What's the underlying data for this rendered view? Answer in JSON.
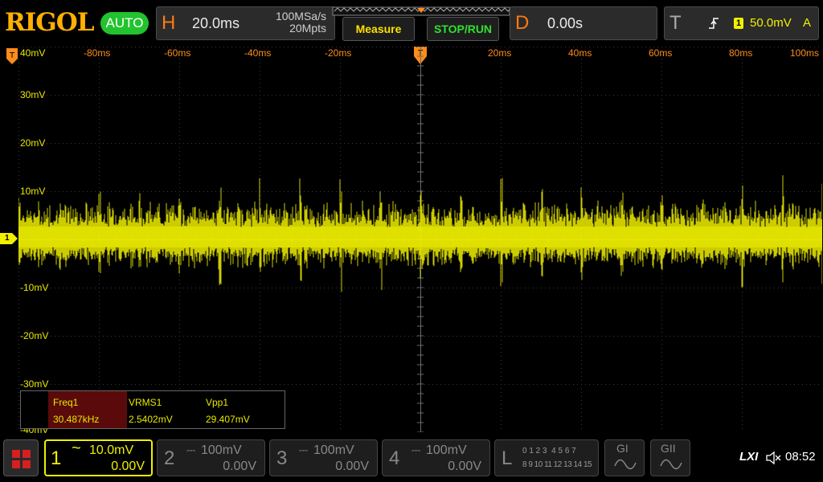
{
  "header": {
    "brand": "RIGOL",
    "trigger_mode": "AUTO",
    "horizontal": {
      "letter": "H",
      "timebase": "20.0ms",
      "sample_rate": "100MSa/s",
      "memory_depth": "20Mpts"
    },
    "measure_button": "Measure",
    "stop_run_button": "STOP/RUN",
    "delay": {
      "letter": "D",
      "value": "0.00s"
    },
    "trigger": {
      "letter": "T",
      "channel": "1",
      "level": "50.0mV",
      "source_mode": "A"
    }
  },
  "grid": {
    "time_labels": [
      "-80ms",
      "-60ms",
      "-40ms",
      "-20ms",
      "20ms",
      "40ms",
      "60ms",
      "80ms",
      "100ms"
    ],
    "volt_labels": [
      "40mV",
      "30mV",
      "20mV",
      "10mV",
      "-10mV",
      "-20mV",
      "-30mV",
      "-40mV"
    ],
    "channel_marker": "1",
    "colors": {
      "ch1": "#f0f000",
      "grid": "#3a3a3a",
      "time": "#ff8c1a"
    }
  },
  "measurements": [
    {
      "name": "Freq1",
      "value": "30.487kHz"
    },
    {
      "name": "VRMS1",
      "value": "2.5402mV"
    },
    {
      "name": "Vpp1",
      "value": "29.407mV"
    }
  ],
  "channels": [
    {
      "num": "1",
      "coupling": "~",
      "scale": "10.0mV",
      "offset": "0.00V"
    },
    {
      "num": "2",
      "coupling": "⎓",
      "scale": "100mV",
      "offset": "0.00V"
    },
    {
      "num": "3",
      "coupling": "⎓",
      "scale": "100mV",
      "offset": "0.00V"
    },
    {
      "num": "4",
      "coupling": "⎓",
      "scale": "100mV",
      "offset": "0.00V"
    }
  ],
  "logic": {
    "letter": "L",
    "row1": "0 1 2 3  4 5 6 7",
    "row2": "8 9 10 11 12 13 14 15"
  },
  "gen1": "GI",
  "gen2": "GII",
  "status": {
    "lxi": "LXI",
    "time": "08:52"
  }
}
